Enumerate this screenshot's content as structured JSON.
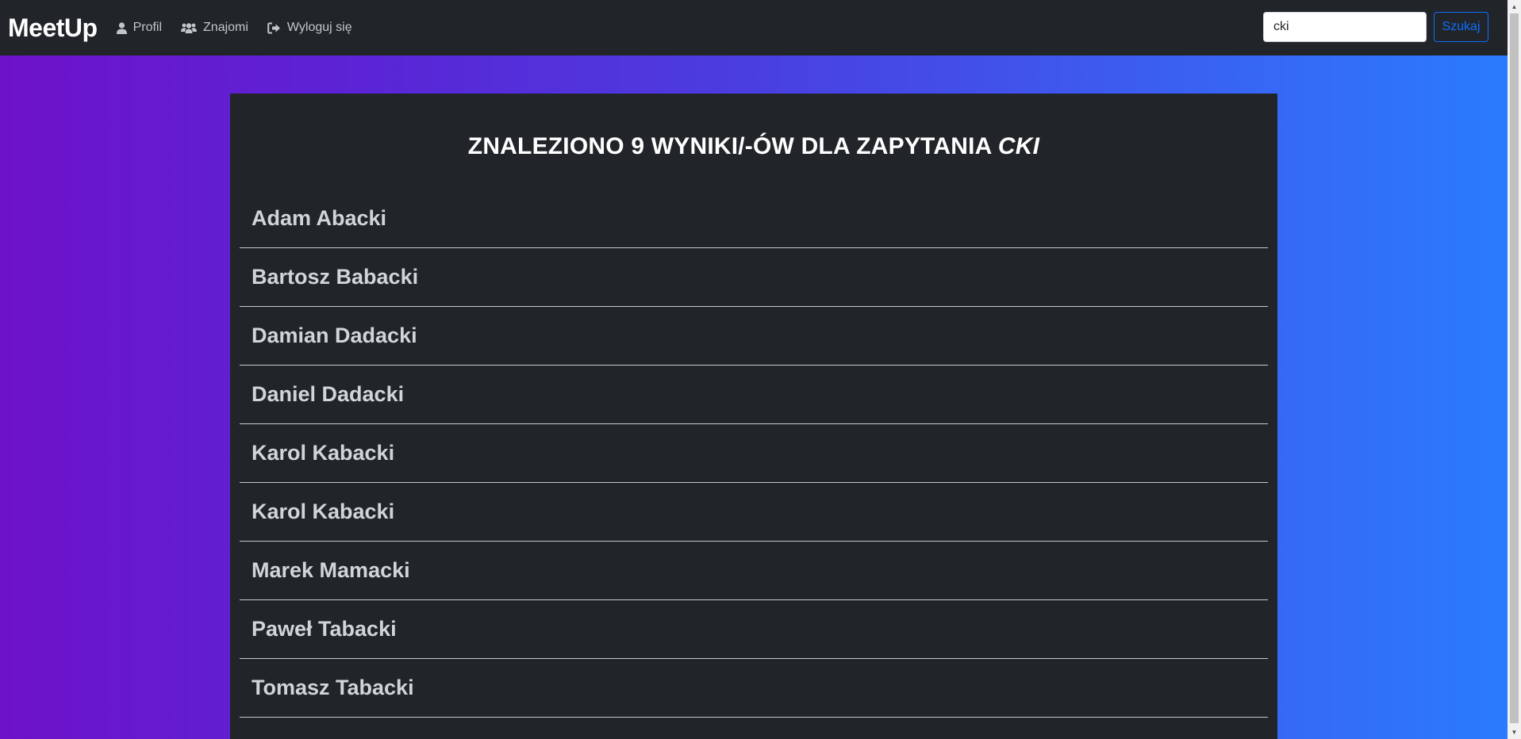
{
  "navbar": {
    "brand": "MeetUp",
    "links": [
      {
        "label": "Profil",
        "icon": "user-icon"
      },
      {
        "label": "Znajomi",
        "icon": "users-icon"
      },
      {
        "label": "Wyloguj się",
        "icon": "logout-icon"
      }
    ],
    "search": {
      "value": "cki",
      "button_label": "Szukaj"
    }
  },
  "results": {
    "title_prefix": "ZNALEZIONO 9 WYNIKI/-ÓW DLA ZAPYTANIA ",
    "query": "CKI",
    "items": [
      "Adam Abacki",
      "Bartosz Babacki",
      "Damian Dadacki",
      "Daniel Dadacki",
      "Karol Kabacki",
      "Karol Kabacki",
      "Marek Mamacki",
      "Paweł Tabacki",
      "Tomasz Tabacki"
    ]
  },
  "colors": {
    "navbar_bg": "#212529",
    "gradient_start": "#6e12c9",
    "gradient_end": "#2a7cff",
    "search_button": "#0d6efd"
  }
}
